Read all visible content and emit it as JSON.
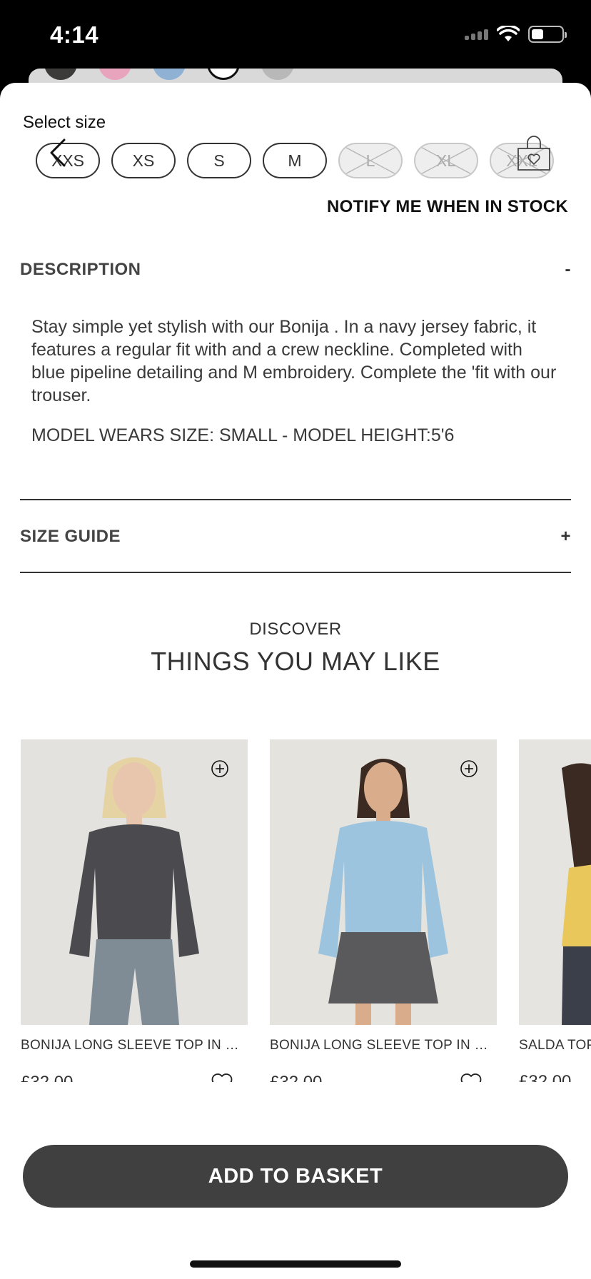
{
  "status_bar": {
    "time": "4:14"
  },
  "size_selector": {
    "label": "Select size",
    "sizes": [
      {
        "label": "XXS",
        "available": true
      },
      {
        "label": "XS",
        "available": true
      },
      {
        "label": "S",
        "available": true
      },
      {
        "label": "M",
        "available": true
      },
      {
        "label": "L",
        "available": false
      },
      {
        "label": "XL",
        "available": false
      },
      {
        "label": "XXL",
        "available": false
      }
    ],
    "notify_label": "NOTIFY ME WHEN IN STOCK"
  },
  "description": {
    "title": "DESCRIPTION",
    "toggle": "-",
    "body": "Stay simple yet stylish with our Bonija . In a navy jersey fabric, it features a regular fit with and a crew neckline. Completed with blue pipeline detailing and M embroidery. Complete the 'fit with our trouser.",
    "model_info": "MODEL WEARS SIZE: SMALL - MODEL HEIGHT:5'6"
  },
  "size_guide": {
    "title": "SIZE GUIDE",
    "toggle": "+"
  },
  "recommendations": {
    "eyebrow": "DISCOVER",
    "title": "THINGS YOU MAY LIKE",
    "products": [
      {
        "name": "BONIJA LONG SLEEVE TOP IN BE...",
        "price": "£32.00",
        "top_color": "#4a4a4f",
        "bottom_color": "#7f8c96"
      },
      {
        "name": "BONIJA LONG SLEEVE TOP IN NA...",
        "price": "£32.00",
        "top_color": "#9cc4de",
        "bottom_color": "#5a5a5c"
      },
      {
        "name": "SALDA TOP",
        "price": "£32.00",
        "top_color": "#e9c75a",
        "bottom_color": "#3b3f4a"
      }
    ]
  },
  "cta": {
    "add_to_basket": "ADD TO BASKET"
  }
}
